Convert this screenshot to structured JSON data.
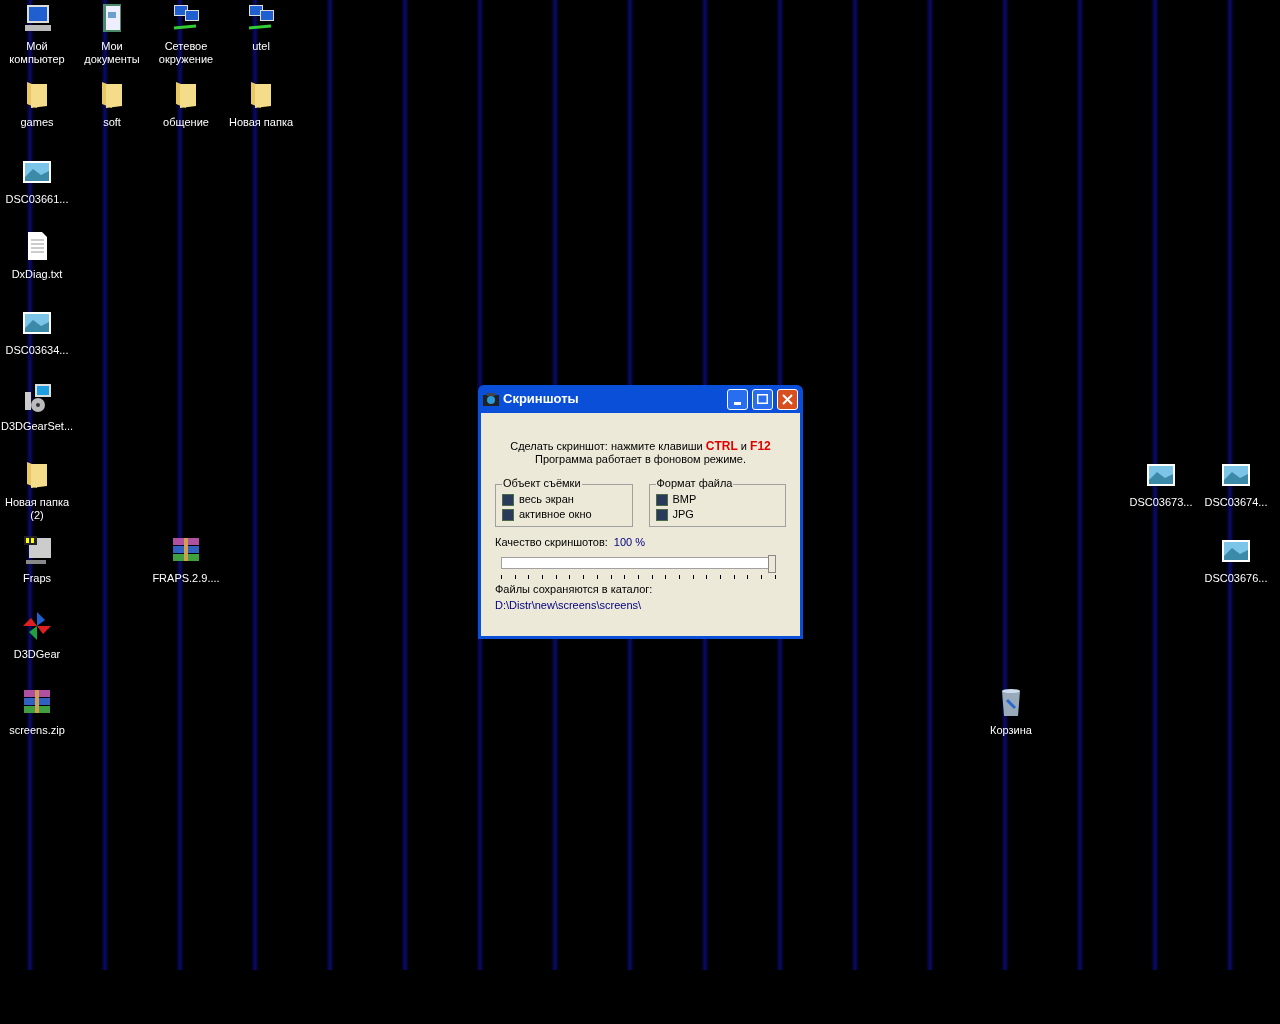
{
  "desktop_icons": [
    {
      "kind": "computer",
      "label": "Мой компьютер"
    },
    {
      "kind": "documents",
      "label": "Мои документы"
    },
    {
      "kind": "network",
      "label": "Сетевое окружение"
    },
    {
      "kind": "network",
      "label": "utel"
    },
    {
      "kind": "folder",
      "label": "games"
    },
    {
      "kind": "folder",
      "label": "soft"
    },
    {
      "kind": "folder",
      "label": "общение"
    },
    {
      "kind": "folder",
      "label": "Новая папка"
    },
    {
      "kind": "image",
      "label": "DSC03661..."
    },
    {
      "kind": "text",
      "label": "DxDiag.txt"
    },
    {
      "kind": "image",
      "label": "DSC03634..."
    },
    {
      "kind": "installer",
      "label": "D3DGearSet..."
    },
    {
      "kind": "folder",
      "label": "Новая папка (2)"
    },
    {
      "kind": "fraps",
      "label": "Fraps"
    },
    {
      "kind": "archive",
      "label": "FRAPS.2.9...."
    },
    {
      "kind": "gear",
      "label": "D3DGear"
    },
    {
      "kind": "archive",
      "label": "screens.zip"
    },
    {
      "kind": "image",
      "label": "DSC03673..."
    },
    {
      "kind": "image",
      "label": "DSC03674..."
    },
    {
      "kind": "image",
      "label": "DSC03676..."
    },
    {
      "kind": "trash",
      "label": "Корзина"
    }
  ],
  "window": {
    "title": "Скриншоты",
    "hint": "Сделать скриншот: нажмите клавиши **CTRL** и **F12**",
    "hint_2": "Программа работает в фоновом режиме.",
    "groups": [
      {
        "title": "Объект съёмки",
        "options": [
          "весь экран",
          "активное окно"
        ]
      },
      {
        "title": "Формат файла",
        "options": [
          "BMP",
          "JPG"
        ]
      }
    ],
    "quality_label": "Качество скриншотов:",
    "quality_value": "100 %",
    "quality_slider": {
      "level": 1
    },
    "folder_label": "Файлы сохраняются в каталог:",
    "folder_path": "D:\\Distr\\new\\screens\\screens\\"
  }
}
